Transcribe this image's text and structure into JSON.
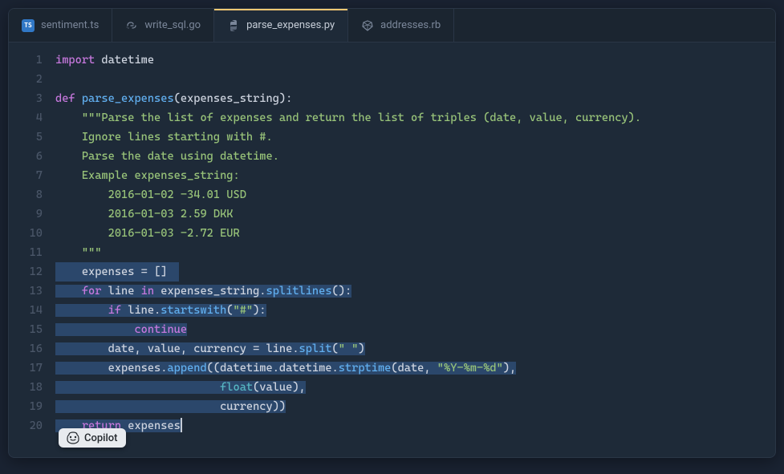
{
  "tabs": [
    {
      "label": "sentiment.ts",
      "icon": "ts",
      "active": false
    },
    {
      "label": "write_sql.go",
      "icon": "go",
      "active": false
    },
    {
      "label": "parse_expenses.py",
      "icon": "py",
      "active": true
    },
    {
      "label": "addresses.rb",
      "icon": "rb",
      "active": false
    }
  ],
  "copilot": {
    "label": "Copilot"
  },
  "code": {
    "lines": [
      {
        "n": 1,
        "tokens": [
          [
            "kw-import",
            "import"
          ],
          [
            "id",
            " datetime"
          ]
        ]
      },
      {
        "n": 2,
        "tokens": []
      },
      {
        "n": 3,
        "tokens": [
          [
            "kw-def",
            "def "
          ],
          [
            "fn",
            "parse_expenses"
          ],
          [
            "punct",
            "("
          ],
          [
            "id",
            "expenses_string"
          ],
          [
            "punct",
            "):"
          ]
        ]
      },
      {
        "n": 4,
        "tokens": [
          [
            "id",
            "    "
          ],
          [
            "str",
            "\"\"\"Parse the list of expenses and return the list of triples (date, value, currency)."
          ]
        ]
      },
      {
        "n": 5,
        "tokens": [
          [
            "id",
            "    "
          ],
          [
            "str",
            "Ignore lines starting with #."
          ]
        ]
      },
      {
        "n": 6,
        "tokens": [
          [
            "id",
            "    "
          ],
          [
            "str",
            "Parse the date using datetime."
          ]
        ]
      },
      {
        "n": 7,
        "tokens": [
          [
            "id",
            "    "
          ],
          [
            "str",
            "Example expenses_string:"
          ]
        ]
      },
      {
        "n": 8,
        "tokens": [
          [
            "id",
            "    "
          ],
          [
            "str",
            "    2016-01-02 -34.01 USD"
          ]
        ]
      },
      {
        "n": 9,
        "tokens": [
          [
            "id",
            "    "
          ],
          [
            "str",
            "    2016-01-03 2.59 DKK"
          ]
        ]
      },
      {
        "n": 10,
        "tokens": [
          [
            "id",
            "    "
          ],
          [
            "str",
            "    2016-01-03 -2.72 EUR"
          ]
        ]
      },
      {
        "n": 11,
        "tokens": [
          [
            "id",
            "    "
          ],
          [
            "str",
            "\"\"\""
          ]
        ]
      },
      {
        "n": 12,
        "hl": "start-partial",
        "tokens": [
          [
            "id",
            "    expenses "
          ],
          [
            "punct",
            "= []"
          ]
        ],
        "hl_from_token": 0
      },
      {
        "n": 13,
        "hl": true,
        "tokens": [
          [
            "id",
            "    "
          ],
          [
            "kw-for",
            "for"
          ],
          [
            "id",
            " line "
          ],
          [
            "kw-in",
            "in"
          ],
          [
            "id",
            " expenses_string"
          ],
          [
            "punct",
            "."
          ],
          [
            "fn",
            "splitlines"
          ],
          [
            "punct",
            "():"
          ]
        ]
      },
      {
        "n": 14,
        "hl": true,
        "tokens": [
          [
            "id",
            "        "
          ],
          [
            "kw-if",
            "if"
          ],
          [
            "id",
            " line"
          ],
          [
            "punct",
            "."
          ],
          [
            "fn",
            "startswith"
          ],
          [
            "punct",
            "("
          ],
          [
            "str",
            "\"#\""
          ],
          [
            "punct",
            "):"
          ]
        ]
      },
      {
        "n": 15,
        "hl": true,
        "tokens": [
          [
            "id",
            "            "
          ],
          [
            "kw-cont",
            "continue"
          ]
        ]
      },
      {
        "n": 16,
        "hl": true,
        "tokens": [
          [
            "id",
            "        date"
          ],
          [
            "punct",
            ", "
          ],
          [
            "id",
            "value"
          ],
          [
            "punct",
            ", "
          ],
          [
            "id",
            "currency "
          ],
          [
            "punct",
            "= "
          ],
          [
            "id",
            "line"
          ],
          [
            "punct",
            "."
          ],
          [
            "fn",
            "split"
          ],
          [
            "punct",
            "("
          ],
          [
            "str",
            "\" \""
          ],
          [
            "punct",
            ")"
          ]
        ]
      },
      {
        "n": 17,
        "hl": true,
        "tokens": [
          [
            "id",
            "        expenses"
          ],
          [
            "punct",
            "."
          ],
          [
            "fn",
            "append"
          ],
          [
            "punct",
            "(("
          ],
          [
            "id",
            "datetime"
          ],
          [
            "punct",
            "."
          ],
          [
            "id",
            "datetime"
          ],
          [
            "punct",
            "."
          ],
          [
            "fn",
            "strptime"
          ],
          [
            "punct",
            "("
          ],
          [
            "id",
            "date"
          ],
          [
            "punct",
            ", "
          ],
          [
            "str",
            "\"%Y-%m-%d\""
          ],
          [
            "punct",
            "),"
          ]
        ]
      },
      {
        "n": 18,
        "hl": true,
        "tokens": [
          [
            "id",
            "                         "
          ],
          [
            "builtin",
            "float"
          ],
          [
            "punct",
            "("
          ],
          [
            "id",
            "value"
          ],
          [
            "punct",
            "),"
          ]
        ]
      },
      {
        "n": 19,
        "hl": true,
        "tokens": [
          [
            "id",
            "                         currency"
          ],
          [
            "punct",
            "))"
          ]
        ]
      },
      {
        "n": 20,
        "hl": true,
        "cursor": true,
        "tokens": [
          [
            "id",
            "    "
          ],
          [
            "kw-return",
            "return"
          ],
          [
            "id",
            " expenses"
          ]
        ]
      }
    ]
  }
}
